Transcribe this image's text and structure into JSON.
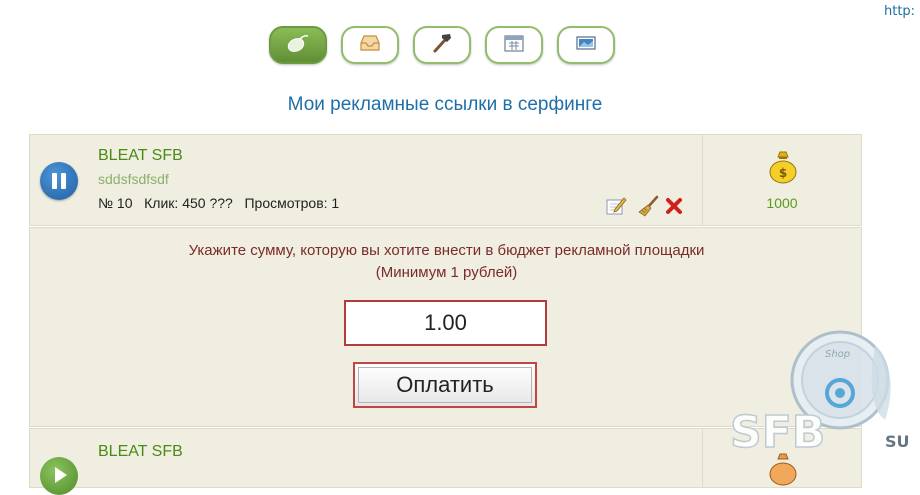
{
  "corner_link": "http:",
  "toolbar": {
    "buttons": [
      {
        "name": "mouse",
        "active": true
      },
      {
        "name": "inbox",
        "active": false
      },
      {
        "name": "hammer",
        "active": false
      },
      {
        "name": "calendar",
        "active": false
      },
      {
        "name": "banner",
        "active": false
      }
    ]
  },
  "page_title": "Мои рекламные ссылки в серфинге",
  "ad1": {
    "title": "BLEAT SFB",
    "subtitle": "sddsfsdfsdf",
    "info": "№ 10   Клик: 450 ???   Просмотров: 1",
    "price": "1000"
  },
  "payment": {
    "prompt": "Укажите сумму, которую вы хотите внести в бюджет рекламной площадки",
    "minimum": "(Минимум 1 рублей)",
    "amount_value": "1.00",
    "pay_label": "Оплатить"
  },
  "ad2": {
    "title": "BLEAT SFB"
  },
  "watermark": {
    "text": "SFB",
    "suffix": "SU",
    "ring_text": "Shop"
  },
  "colors": {
    "title_blue": "#1f6fa8",
    "link_green": "#4a8a16",
    "prompt_red": "#7a2b2b",
    "panel_bg": "#f0eee0"
  }
}
